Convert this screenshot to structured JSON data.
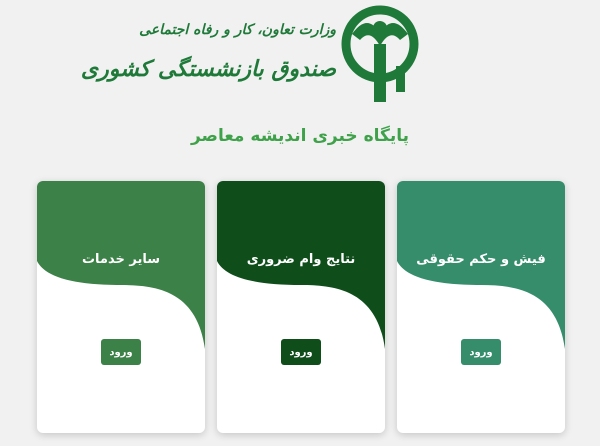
{
  "header": {
    "ministry_text": "وزارت تعاون، کار و رفاه اجتماعی",
    "fund_text": "صندوق بازنشستگی کشوری",
    "logo_color": "#1f7a3a"
  },
  "site_title": "پایگاه خبری اندیشه معاصر",
  "cards": [
    {
      "title": "فیش و حکم حقوقی",
      "button_label": "ورود",
      "color": "#358d6c"
    },
    {
      "title": "نتایج وام ضروری",
      "button_label": "ورود",
      "color": "#0f4d1b"
    },
    {
      "title": "سایر خدمات",
      "button_label": "ورود",
      "color": "#3c8147"
    }
  ]
}
